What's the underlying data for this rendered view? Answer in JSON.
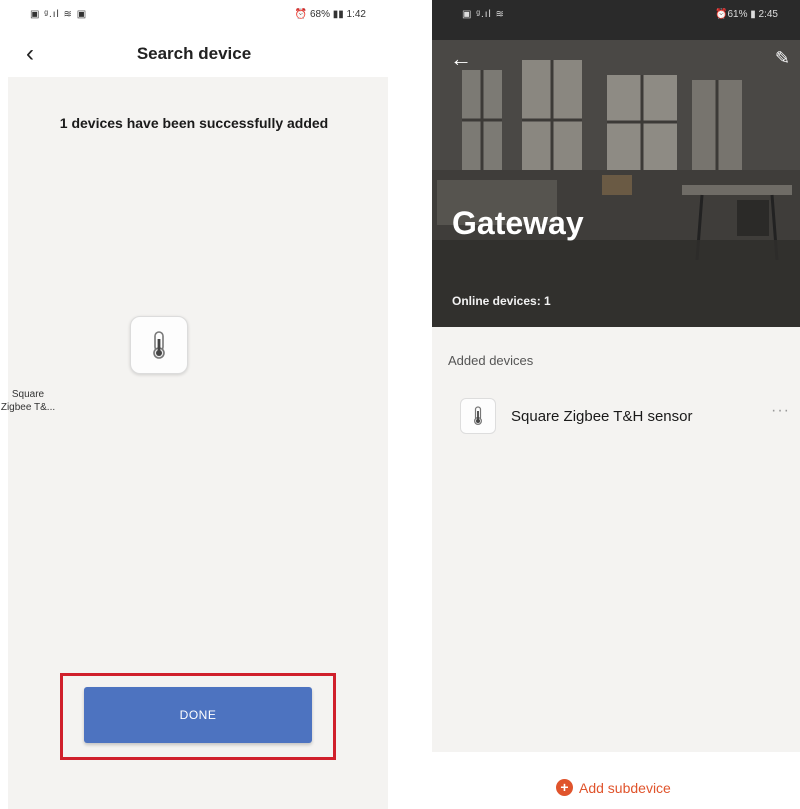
{
  "left": {
    "status_left": "▣ ᵍ.ıl ≋ ▣",
    "status_right": "⏰ 68% ▮▮ 1:42",
    "back_icon": "‹",
    "title": "Search device",
    "message": "1 devices have been successfully added",
    "device": {
      "name_line1": "Square",
      "name_line2": "Zigbee T&...",
      "icon": "thermometer-icon"
    },
    "done_label": "DONE",
    "highlight_color": "#d0202b",
    "button_color": "#4d73c0"
  },
  "right": {
    "status_left": "▣ ᵍ.ıl ≋",
    "status_right": "⏰61% ▮ 2:45",
    "back_icon": "←",
    "edit_icon": "✎",
    "title": "Gateway",
    "online": "Online devices: 1",
    "section_label": "Added devices",
    "devices": [
      {
        "name": "Square Zigbee T&H sensor",
        "icon": "thermometer-icon",
        "more": "···"
      }
    ],
    "add_icon": "+",
    "add_label": "Add subdevice",
    "accent_color": "#e0542c"
  }
}
